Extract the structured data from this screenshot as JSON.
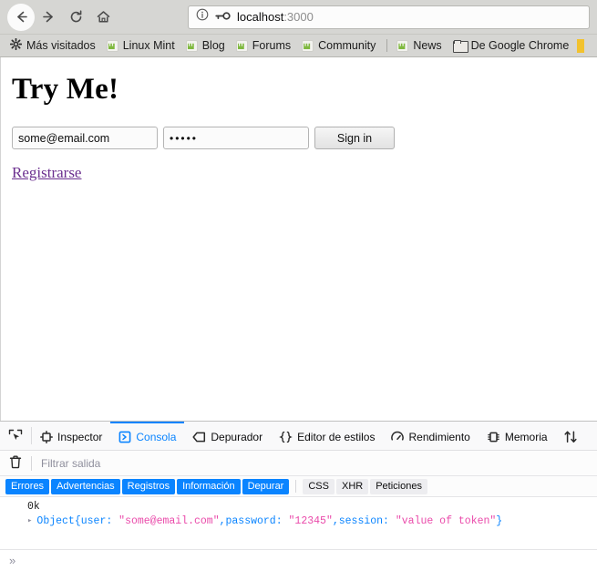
{
  "browser": {
    "nav": {
      "back_label": "Back",
      "forward_label": "Forward",
      "reload_label": "Reload",
      "home_label": "Home"
    },
    "url": {
      "host": "localhost",
      "port": ":3000",
      "info_icon": "info-circle-icon",
      "permission_icon": "key-icon"
    },
    "bookmarks": [
      {
        "label": "Más visitados",
        "icon": "gear-icon"
      },
      {
        "label": "Linux Mint",
        "icon": "linux-mint-icon"
      },
      {
        "label": "Blog",
        "icon": "linux-mint-icon"
      },
      {
        "label": "Forums",
        "icon": "linux-mint-icon"
      },
      {
        "label": "Community",
        "icon": "linux-mint-icon"
      },
      {
        "label": "News",
        "icon": "linux-mint-icon"
      },
      {
        "label": "De Google Chrome",
        "icon": "folder-icon"
      }
    ]
  },
  "page": {
    "title": "Try Me!",
    "email": {
      "value": "some@email.com",
      "placeholder": ""
    },
    "password": {
      "value": "•••••",
      "placeholder": ""
    },
    "signin_label": "Sign in",
    "register_link": "Registrarse"
  },
  "devtools": {
    "tabs": [
      {
        "label": "Inspector",
        "icon": "inspector-icon",
        "selected": false
      },
      {
        "label": "Consola",
        "icon": "console-icon",
        "selected": true
      },
      {
        "label": "Depurador",
        "icon": "debugger-icon",
        "selected": false
      },
      {
        "label": "Editor de estilos",
        "icon": "style-editor-icon",
        "selected": false
      },
      {
        "label": "Rendimiento",
        "icon": "performance-icon",
        "selected": false
      },
      {
        "label": "Memoria",
        "icon": "memory-icon",
        "selected": false
      },
      {
        "label": "",
        "icon": "network-icon",
        "selected": false
      }
    ],
    "picker_icon": "element-picker-icon",
    "clear_icon": "trash-icon",
    "filter": {
      "value": "",
      "placeholder": "Filtrar salida"
    },
    "chips_on": [
      "Errores",
      "Advertencias",
      "Registros",
      "Información",
      "Depurar"
    ],
    "chips_off": [
      "CSS",
      "XHR",
      "Peticiones"
    ],
    "console_logs": [
      {
        "kind": "plain",
        "text": "0k"
      }
    ],
    "object_log": {
      "expander": "▸",
      "type": "Object",
      "open_brace": " { ",
      "close_brace": " }",
      "entries": [
        {
          "key": "user:",
          "value": "\"some@email.com\"",
          "sep": ", "
        },
        {
          "key": "password:",
          "value": "\"12345\"",
          "sep": ", "
        },
        {
          "key": "session:",
          "value": "\"value of token\"",
          "sep": ""
        }
      ]
    },
    "prompt": {
      "chevron": "»",
      "value": "",
      "placeholder": ""
    }
  },
  "colors": {
    "accent_blue": "#0a84ff",
    "string_pink": "#ea4aaa",
    "link_purple": "#6b2f8f",
    "chrome_gray": "#d6d6d3"
  }
}
